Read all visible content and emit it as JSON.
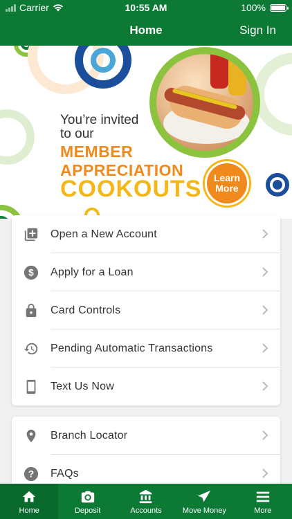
{
  "status_bar": {
    "carrier": "Carrier",
    "time": "10:55 AM",
    "battery": "100%"
  },
  "nav": {
    "title": "Home",
    "sign_in": "Sign In"
  },
  "banner": {
    "line1": "You’re invited",
    "line2": "to our",
    "line3": "MEMBER",
    "line4": "APPRECIATION",
    "line5": "COOKOUTS",
    "learn_more_1": "Learn",
    "learn_more_2": "More"
  },
  "menu_primary": [
    {
      "label": "Open a New Account",
      "icon": "add-account-icon"
    },
    {
      "label": "Apply for a Loan",
      "icon": "dollar-icon"
    },
    {
      "label": "Card Controls",
      "icon": "lock-icon"
    },
    {
      "label": "Pending Automatic Transactions",
      "icon": "history-icon"
    },
    {
      "label": "Text Us Now",
      "icon": "phone-icon"
    }
  ],
  "menu_secondary": [
    {
      "label": "Branch Locator",
      "icon": "location-pin-icon"
    },
    {
      "label": "FAQs",
      "icon": "help-icon"
    }
  ],
  "tabs": [
    {
      "label": "Home",
      "icon": "home-icon",
      "active": true
    },
    {
      "label": "Deposit",
      "icon": "camera-icon"
    },
    {
      "label": "Accounts",
      "icon": "bank-icon"
    },
    {
      "label": "Move Money",
      "icon": "send-icon"
    },
    {
      "label": "More",
      "icon": "menu-icon"
    }
  ],
  "colors": {
    "brand_green": "#0c7a35",
    "orange": "#f08a1c",
    "yellow": "#f5b717",
    "icon_gray": "#757575"
  }
}
